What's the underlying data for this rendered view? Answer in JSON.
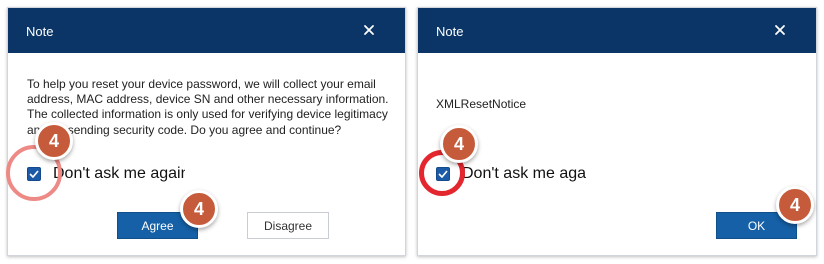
{
  "left_dialog": {
    "title": "Note",
    "message": "To help you reset your device password, we will collect your email address, MAC address, device SN and other necessary information. The collected information is only used for verifying device legitimacy and for sending security code. Do you agree and continue?",
    "checkbox": {
      "label": "Don't ask me again",
      "checked": true
    },
    "agree_label": "Agree",
    "disagree_label": "Disagree"
  },
  "right_dialog": {
    "title": "Note",
    "message": "XMLResetNotice",
    "checkbox": {
      "label": "Don't ask me again",
      "checked": true
    },
    "ok_label": "OK"
  },
  "annotations": {
    "badge_number": "4",
    "badge_color": "#c65b3b",
    "ring_left_color": "#ee8a86",
    "ring_right_color": "#e4262e"
  },
  "colors": {
    "titlebar": "#0a3566",
    "primary_button": "#1560a6",
    "checkbox": "#1c5aa7"
  },
  "icons": {
    "close": "close-icon",
    "check": "checkmark-icon"
  }
}
